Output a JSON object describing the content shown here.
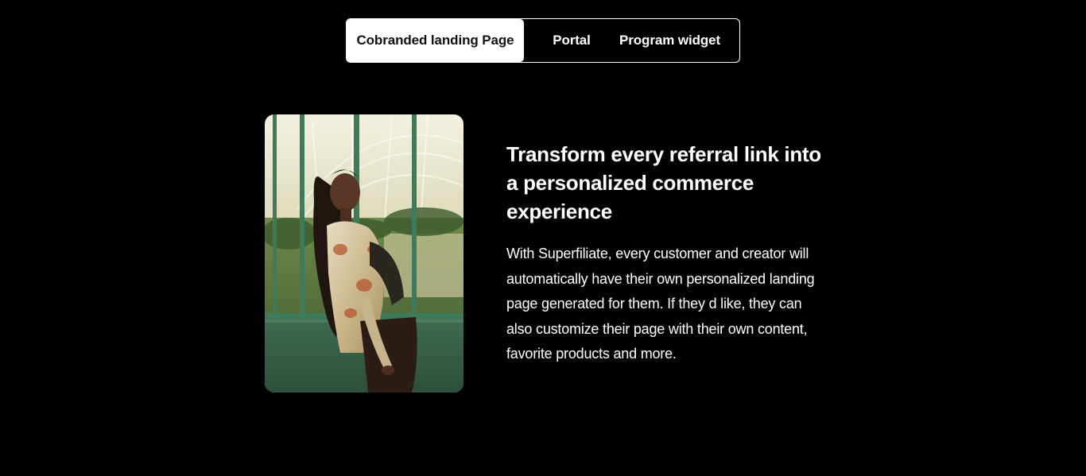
{
  "tabs": [
    {
      "label": "Cobranded landing Page",
      "active": true
    },
    {
      "label": "Portal",
      "active": false
    },
    {
      "label": "Program widget",
      "active": false
    }
  ],
  "feature": {
    "headline": "Transform every referral link into a personalized commerce experience",
    "body": "With Superfiliate, every customer and creator will automatically have their own personalized landing page generated for them. If they d like, they can also customize their page with their own content, favorite products and more."
  },
  "colors": {
    "background": "#000000",
    "text": "#ffffff",
    "active_tab_bg": "#ffffff",
    "active_tab_text": "#111111"
  }
}
